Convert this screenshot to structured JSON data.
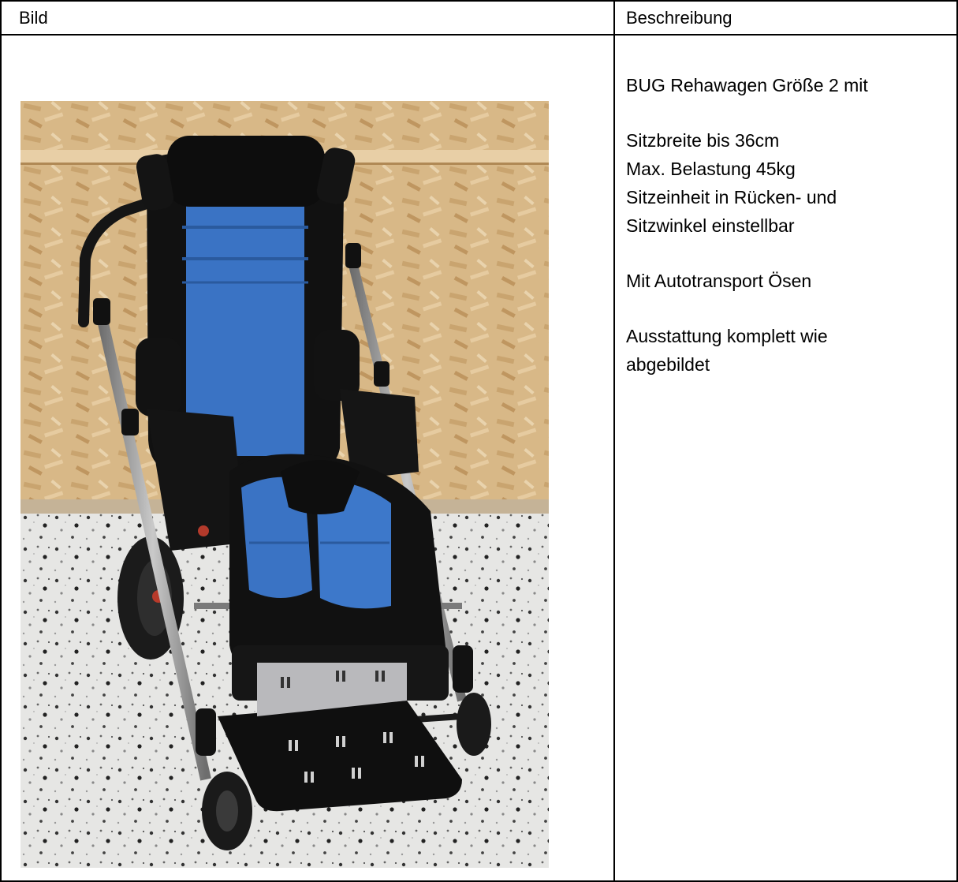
{
  "table": {
    "header_left": "Bild",
    "header_right": "Beschreibung"
  },
  "description": {
    "title": "BUG Rehawagen Größe 2 mit",
    "specs": [
      "Sitzbreite bis 36cm",
      "Max. Belastung 45kg",
      "Sitzeinheit in Rücken- und",
      "Sitzwinkel einstellbar"
    ],
    "feature": "Mit Autotransport Ösen",
    "equipment": [
      "Ausstattung komplett wie",
      "abgebildet"
    ]
  },
  "colors": {
    "seat_blue": "#3a73c4",
    "frame_black": "#111111",
    "wall_wood": "#d9b98a",
    "floor_terrazzo": "#e4e4e4"
  }
}
